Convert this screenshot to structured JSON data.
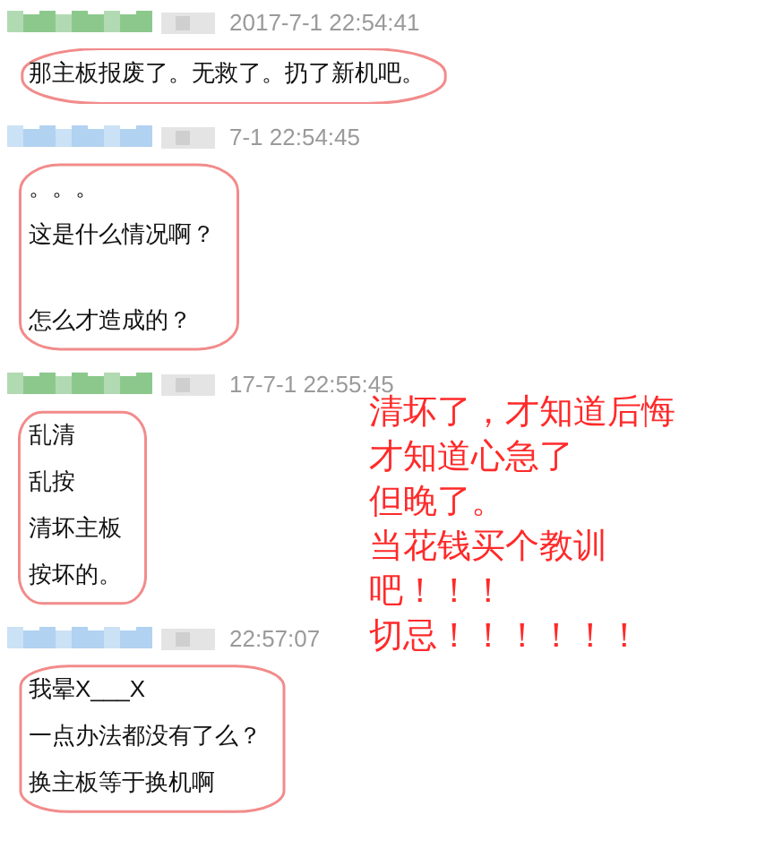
{
  "messages": [
    {
      "color": "#7fc27f",
      "timestamp": "2017-7-1 22:54:41",
      "circled": true,
      "lines": [
        {
          "kind": "text",
          "text": "那主板报废了。无救了。扔了新机吧。"
        }
      ]
    },
    {
      "color": "#a9cdee",
      "timestamp": "7-1 22:54:45",
      "circled": true,
      "lines": [
        {
          "kind": "text",
          "text": "。。。"
        },
        {
          "kind": "text",
          "text": "这是什么情况啊？"
        },
        {
          "kind": "gap"
        },
        {
          "kind": "text",
          "text": "怎么才造成的？"
        }
      ]
    },
    {
      "color": "#7fc27f",
      "timestamp": "17-7-1 22:55:45",
      "circled": true,
      "lines": [
        {
          "kind": "text",
          "text": "乱清"
        },
        {
          "kind": "text",
          "text": "乱按"
        },
        {
          "kind": "text",
          "text": "清坏主板"
        },
        {
          "kind": "text",
          "text": "按坏的。"
        }
      ]
    },
    {
      "color": "#a9cdee",
      "timestamp": "22:57:07",
      "circled": true,
      "lines": [
        {
          "kind": "text",
          "text": "我晕X___X"
        },
        {
          "kind": "text",
          "text": "一点办法都没有了么？"
        },
        {
          "kind": "text",
          "text": "换主板等于换机啊"
        }
      ]
    }
  ],
  "annotation": {
    "lines": [
      "清坏了，才知道后悔",
      "才知道心急了",
      "但晚了。",
      "当花钱买个教训",
      "吧！！！",
      "切忌！！！！！！"
    ]
  }
}
